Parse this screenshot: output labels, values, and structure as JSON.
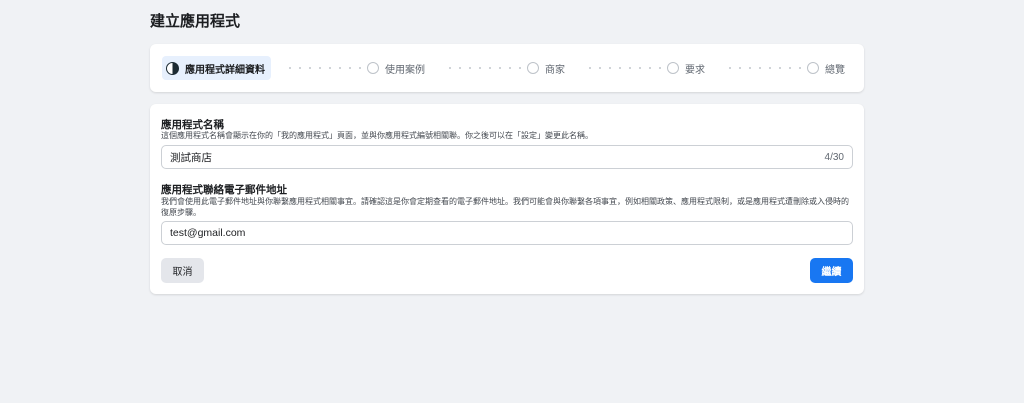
{
  "page": {
    "title": "建立應用程式"
  },
  "stepper": {
    "steps": [
      {
        "label": "應用程式詳細資料",
        "state": "active",
        "icon": "half-circle-icon"
      },
      {
        "label": "使用案例",
        "state": "pending",
        "icon": "circle-icon"
      },
      {
        "label": "商家",
        "state": "pending",
        "icon": "circle-icon"
      },
      {
        "label": "要求",
        "state": "pending",
        "icon": "circle-icon"
      },
      {
        "label": "總覽",
        "state": "pending",
        "icon": "circle-icon"
      }
    ]
  },
  "form": {
    "app_name": {
      "label": "應用程式名稱",
      "description": "這個應用程式名稱會顯示在你的「我的應用程式」頁面，並與你應用程式編號相關聯。你之後可以在「設定」變更此名稱。",
      "value": "測試商店",
      "counter": "4/30"
    },
    "contact_email": {
      "label": "應用程式聯絡電子郵件地址",
      "description": "我們會使用此電子郵件地址與你聯繫應用程式相關事宜。請確認這是你會定期查看的電子郵件地址。我們可能會與你聯繫各項事宜，例如相關政策、應用程式限制，或是應用程式遭刪除或入侵時的復原步驟。",
      "value": "test@gmail.com"
    }
  },
  "actions": {
    "cancel_label": "取消",
    "continue_label": "繼續"
  },
  "colors": {
    "primary": "#1877f2",
    "background": "#f0f2f5",
    "active_step_bg": "#e7f0fd"
  }
}
